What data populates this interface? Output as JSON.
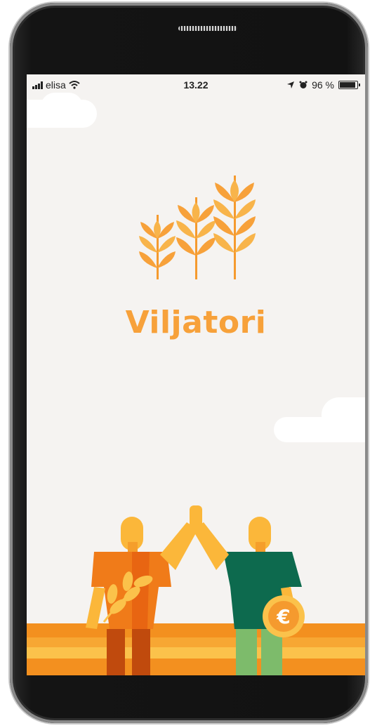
{
  "status_bar": {
    "carrier": "elisa",
    "time": "13.22",
    "battery_percent": "96 %"
  },
  "app": {
    "name": "Viljatori"
  },
  "icons": {
    "coin_symbol": "€"
  },
  "colors": {
    "brand_orange": "#f7a13a",
    "background": "#f5f3f1",
    "field_orange": "#f3901f",
    "field_yellow": "#fbc24b",
    "green_shirt": "#0d6a4e",
    "orange_shirt": "#f07b19"
  }
}
